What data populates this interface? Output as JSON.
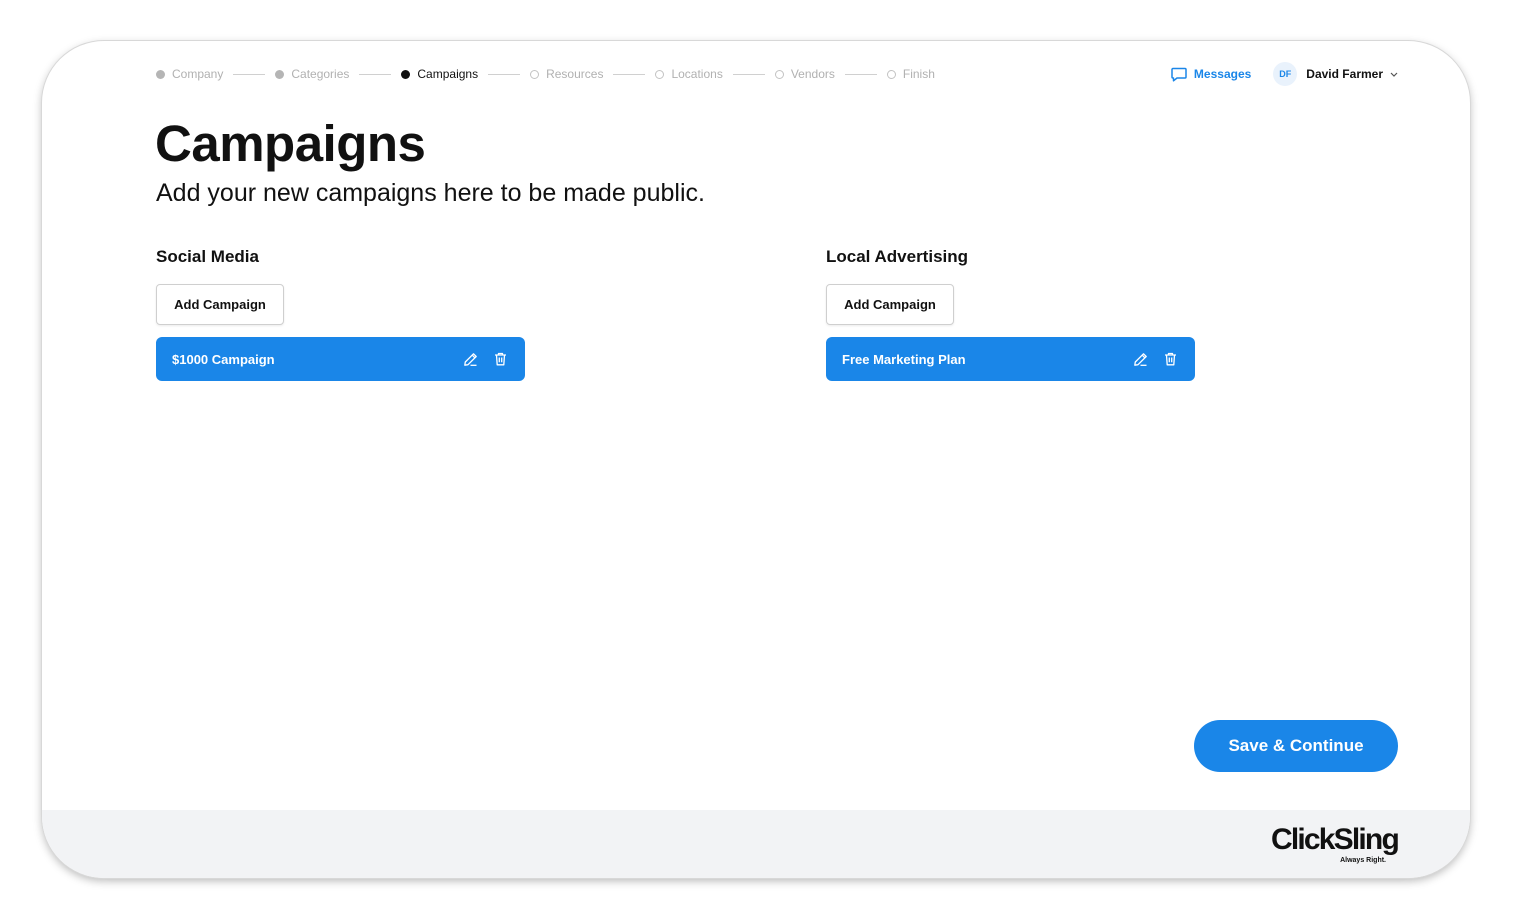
{
  "stepper": {
    "steps": [
      {
        "label": "Company",
        "state": "done"
      },
      {
        "label": "Categories",
        "state": "done"
      },
      {
        "label": "Campaigns",
        "state": "current"
      },
      {
        "label": "Resources",
        "state": "todo"
      },
      {
        "label": "Locations",
        "state": "todo"
      },
      {
        "label": "Vendors",
        "state": "todo"
      },
      {
        "label": "Finish",
        "state": "todo"
      }
    ]
  },
  "header": {
    "messages_label": "Messages",
    "messages_icon": "chat-bubble-icon",
    "user": {
      "initials": "DF",
      "name": "David Farmer",
      "menu_icon": "chevron-down-icon"
    }
  },
  "page": {
    "title": "Campaigns",
    "subtitle": "Add your new campaigns here to be made public."
  },
  "sections": {
    "social": {
      "title": "Social Media",
      "add_label": "Add Campaign",
      "campaigns": [
        {
          "name": "$1000 Campaign",
          "edit_icon": "pencil-icon",
          "delete_icon": "trash-icon"
        }
      ]
    },
    "local": {
      "title": "Local Advertising",
      "add_label": "Add Campaign",
      "campaigns": [
        {
          "name": "Free Marketing Plan",
          "edit_icon": "pencil-icon",
          "delete_icon": "trash-icon"
        }
      ]
    }
  },
  "actions": {
    "save_label": "Save & Continue"
  },
  "footer": {
    "logo_text": "ClickSling",
    "tagline": "Always Right."
  },
  "colors": {
    "accent": "#1a86e8",
    "text": "#111111",
    "muted": "#b1b1b1",
    "footer_bg": "#f2f3f5"
  }
}
